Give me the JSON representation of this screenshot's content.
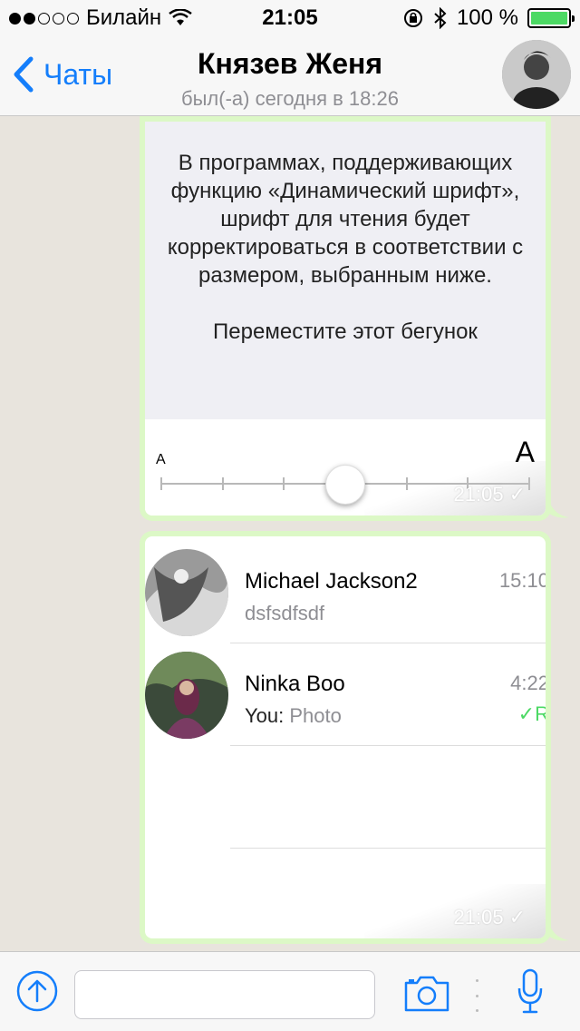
{
  "status_bar": {
    "signal_dots_filled": 2,
    "signal_dots_total": 5,
    "carrier": "Билайн",
    "time": "21:05",
    "battery_percent": "100 %",
    "battery_color": "#4cd964"
  },
  "header": {
    "back_label": "Чаты",
    "contact_name": "Князев Женя",
    "last_seen": "был(-а) сегодня в 18:26",
    "accent_color": "#147efb"
  },
  "messages": [
    {
      "type": "image",
      "content": {
        "paragraph1": "В программах, поддерживающих функцию «Динамический шрифт», шрифт для чтения будет корректироваться в соответствии с размером, выбранным ниже.",
        "paragraph2": "Переместите этот бегунок",
        "slider_small_label": "A",
        "slider_large_label": "A",
        "slider_position_step": 3,
        "slider_steps": 7
      },
      "time": "21:05",
      "status": "✓"
    },
    {
      "type": "image",
      "chats": [
        {
          "name": "Michael Jackson2",
          "time": "15:10",
          "preview": "dsfsdfsdf"
        },
        {
          "name": "Ninka Boo",
          "time": "4:22",
          "preview_sender": "You:",
          "preview": "Photo",
          "read_mark": "✓R"
        }
      ],
      "time": "21:05",
      "status": "✓"
    }
  ],
  "input": {
    "placeholder": ""
  }
}
